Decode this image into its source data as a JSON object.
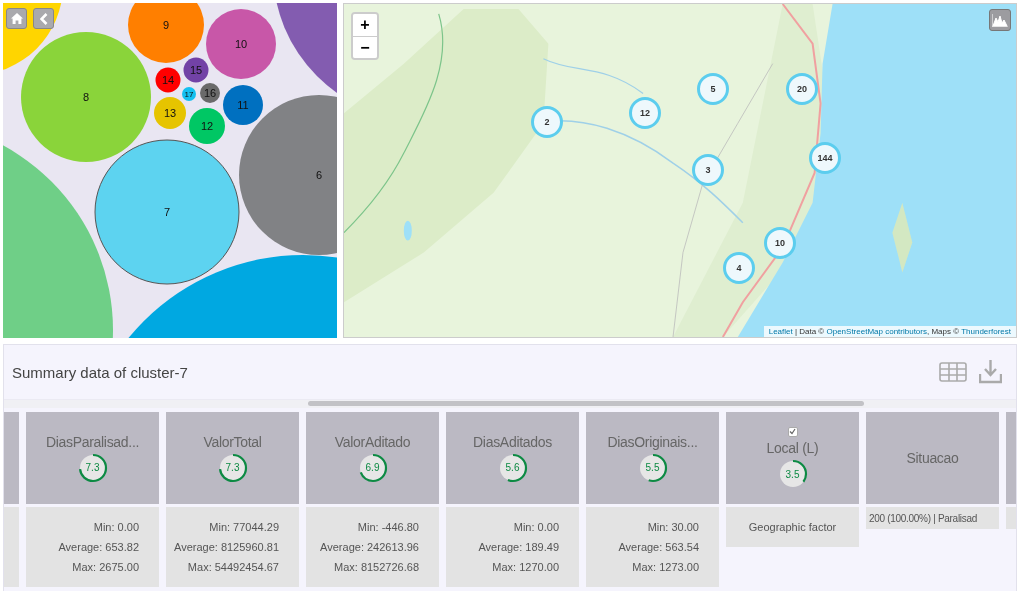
{
  "bubble_chart": {
    "buttons": [
      {
        "kind": "home"
      },
      {
        "kind": "back"
      }
    ],
    "bubbles": [
      {
        "color": "#ffd500",
        "selected": false
      },
      {
        "label": "9",
        "color": "#ff7f00",
        "selected": false
      },
      {
        "label": "10",
        "color": "#c857a8",
        "selected": false
      },
      {
        "color": "#835cb0",
        "selected": false
      },
      {
        "label": "8",
        "color": "#8ad43a",
        "selected": false
      },
      {
        "label": "14",
        "color": "#ff0000",
        "selected": false
      },
      {
        "label": "15",
        "color": "#7242a6",
        "selected": false
      },
      {
        "label": "17",
        "color": "#14c0f0",
        "selected": false
      },
      {
        "label": "16",
        "color": "#6a6a6a",
        "selected": false
      },
      {
        "label": "13",
        "color": "#e6c400",
        "selected": false
      },
      {
        "label": "12",
        "color": "#00c764",
        "selected": false
      },
      {
        "label": "11",
        "color": "#0070c0",
        "selected": false
      },
      {
        "label": "6",
        "color": "#818285",
        "selected": false
      },
      {
        "label": "7",
        "color": "#5dd3f0",
        "selected": true
      },
      {
        "color": "#6fcf87",
        "selected": false
      },
      {
        "color": "#00a8e1",
        "selected": false
      }
    ]
  },
  "map": {
    "zoom_in": "+",
    "zoom_out": "−",
    "markers": [
      {
        "label": "2"
      },
      {
        "label": "12"
      },
      {
        "label": "5"
      },
      {
        "label": "20"
      },
      {
        "label": "3"
      },
      {
        "label": "144"
      },
      {
        "label": "10"
      },
      {
        "label": "4"
      }
    ],
    "attribution": [
      {
        "kind": "link",
        "text": "Leaflet"
      },
      {
        "kind": "text",
        "text": " | Data © "
      },
      {
        "kind": "link",
        "text": "OpenStreetMap contributors"
      },
      {
        "kind": "text",
        "text": ", Maps © "
      },
      {
        "kind": "link",
        "text": "Thunderforest"
      }
    ]
  },
  "summary": {
    "title": "Summary data of cluster-7",
    "columns": [
      {
        "kind": "numeric",
        "name": "DiasParalisad...",
        "score": "7.3",
        "lines": [
          "Min: 0.00",
          "Average: 653.82",
          "Max: 2675.00"
        ]
      },
      {
        "kind": "numeric",
        "name": "ValorTotal",
        "score": "7.3",
        "lines": [
          "Min: 77044.29",
          "Average: 8125960.81",
          "Max: 54492454.67"
        ]
      },
      {
        "kind": "numeric",
        "name": "ValorAditado",
        "score": "6.9",
        "lines": [
          "Min: -446.80",
          "Average: 242613.96",
          "Max: 8152726.68"
        ]
      },
      {
        "kind": "numeric",
        "name": "DiasAditados",
        "score": "5.6",
        "lines": [
          "Min: 0.00",
          "Average: 189.49",
          "Max: 1270.00"
        ]
      },
      {
        "kind": "numeric",
        "name": "DiasOriginais...",
        "score": "5.5",
        "lines": [
          "Min: 30.00",
          "Average: 563.54",
          "Max: 1273.00"
        ]
      },
      {
        "kind": "factor",
        "name": "Local  (L)",
        "checked": true,
        "score": "3.5",
        "text": "Geographic factor"
      },
      {
        "kind": "category",
        "name": "Situacao",
        "text": "200 (100.00%) | Paralisad"
      }
    ]
  }
}
